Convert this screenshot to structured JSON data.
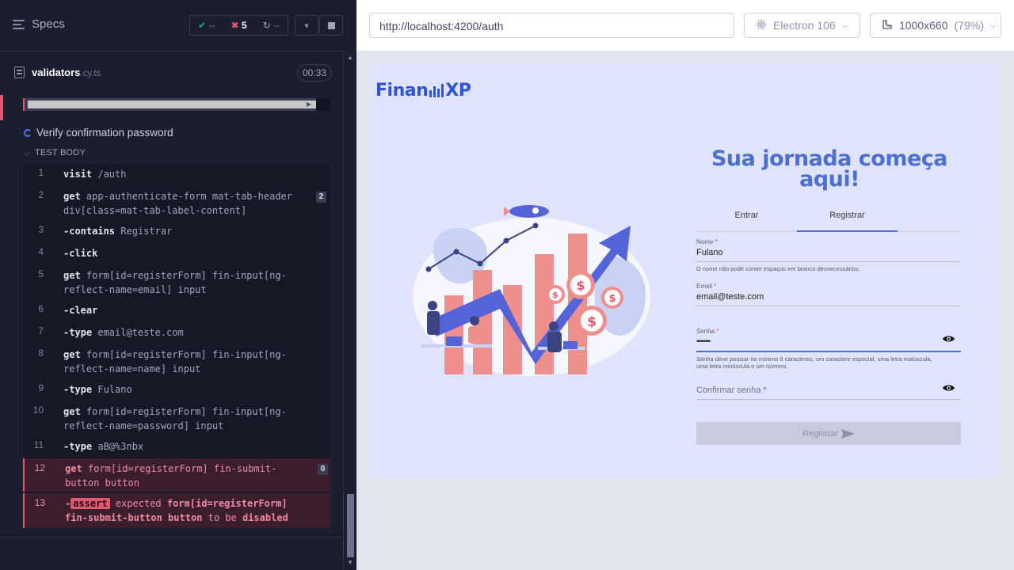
{
  "reporter": {
    "specs_label": "Specs",
    "stats": {
      "passed": "--",
      "failed": "5",
      "pending": "--"
    },
    "file": {
      "name": "validators",
      "ext": ".cy.ts",
      "time": "00:33"
    },
    "test_title": "Verify confirmation password",
    "section_label": "TEST BODY",
    "commands": [
      {
        "num": "1",
        "name": "visit",
        "arg": "/auth"
      },
      {
        "num": "2",
        "name": "get",
        "arg": "app-authenticate-form mat-tab-header div[class=mat-tab-label-content]",
        "badge": "2"
      },
      {
        "num": "3",
        "name": "-contains",
        "arg": "Registrar"
      },
      {
        "num": "4",
        "name": "-click",
        "arg": ""
      },
      {
        "num": "5",
        "name": "get",
        "arg": "form[id=registerForm] fin-input[ng-reflect-name=email] input"
      },
      {
        "num": "6",
        "name": "-clear",
        "arg": ""
      },
      {
        "num": "7",
        "name": "-type",
        "arg": "email@teste.com"
      },
      {
        "num": "8",
        "name": "get",
        "arg": "form[id=registerForm] fin-input[ng-reflect-name=name] input"
      },
      {
        "num": "9",
        "name": "-type",
        "arg": "Fulano"
      },
      {
        "num": "10",
        "name": "get",
        "arg": "form[id=registerForm] fin-input[ng-reflect-name=password] input"
      },
      {
        "num": "11",
        "name": "-type",
        "arg": "aB@%3nbx"
      },
      {
        "num": "12",
        "name": "get",
        "arg": "form[id=registerForm] fin-submit-button button",
        "badge": "0"
      },
      {
        "num": "13",
        "name": "-",
        "tag": "assert",
        "expected": "expected",
        "target": "form[id=registerForm] fin-submit-button button",
        "tobe": "to be",
        "state": "disabled"
      }
    ]
  },
  "aut": {
    "url": "http://localhost:4200/auth",
    "browser": "Electron 106",
    "viewport": "1000x660",
    "zoom": "(79%)"
  },
  "app": {
    "logo_left": "Finan",
    "logo_right": "XP",
    "heading": "Sua jornada começa aqui!",
    "tabs": [
      "Entrar",
      "Registrar"
    ],
    "active_tab": 1,
    "fields": {
      "name": {
        "label": "Nome",
        "value": "Fulano",
        "hint": "O nome não pode conter espaços em branco desnecessários."
      },
      "email": {
        "label": "Email",
        "value": "email@teste.com"
      },
      "password": {
        "label": "Senha",
        "value": "••••••••",
        "hint": "Senha deve possuir no mínimo 8 caracteres, um caractere especial, uma letra maiúscula, uma letra minúscula e um número."
      },
      "confirm": {
        "placeholder": "Confirmar senha",
        "required_mark": "*"
      }
    },
    "submit_label": "Registrar"
  },
  "colors": {
    "reporter_bg": "#1b1e2e",
    "fail_accent": "#e45770",
    "pass_accent": "#1fa971",
    "app_bg": "#dfe3fb",
    "brand_blue": "#2f55d4",
    "heading_blue": "#4d6fd0"
  }
}
